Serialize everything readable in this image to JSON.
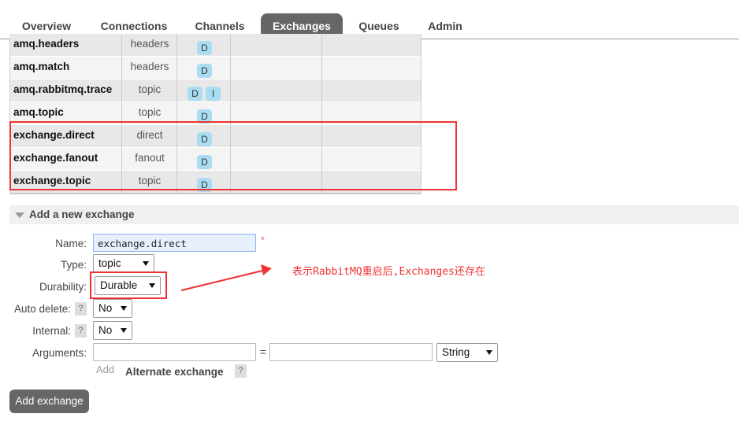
{
  "tabs": [
    {
      "label": "Overview",
      "active": false
    },
    {
      "label": "Connections",
      "active": false
    },
    {
      "label": "Channels",
      "active": false
    },
    {
      "label": "Exchanges",
      "active": true
    },
    {
      "label": "Queues",
      "active": false
    },
    {
      "label": "Admin",
      "active": false
    }
  ],
  "exchanges": [
    {
      "name": "amq.headers",
      "type": "headers",
      "features": [
        "D"
      ]
    },
    {
      "name": "amq.match",
      "type": "headers",
      "features": [
        "D"
      ]
    },
    {
      "name": "amq.rabbitmq.trace",
      "type": "topic",
      "features": [
        "D",
        "I"
      ]
    },
    {
      "name": "amq.topic",
      "type": "topic",
      "features": [
        "D"
      ]
    },
    {
      "name": "exchange.direct",
      "type": "direct",
      "features": [
        "D"
      ]
    },
    {
      "name": "exchange.fanout",
      "type": "fanout",
      "features": [
        "D"
      ]
    },
    {
      "name": "exchange.topic",
      "type": "topic",
      "features": [
        "D"
      ]
    }
  ],
  "add_section": {
    "title": "Add a new exchange"
  },
  "form": {
    "name_label": "Name:",
    "name_value": "exchange.direct",
    "required_mark": "*",
    "type_label": "Type:",
    "type_value": "topic",
    "durability_label": "Durability:",
    "durability_value": "Durable",
    "auto_delete_label": "Auto delete:",
    "auto_delete_value": "No",
    "internal_label": "Internal:",
    "internal_value": "No",
    "arguments_label": "Arguments:",
    "equals": "=",
    "arg_type_value": "String",
    "help": "?",
    "add_link": "Add",
    "alternate_exchange": "Alternate exchange",
    "submit": "Add exchange"
  },
  "annotation": "表示RabbitMQ重启后,Exchanges还存在",
  "colors": {
    "accent_red": "#e33333",
    "badge": "#aaddf2",
    "active_tab": "#666666"
  }
}
